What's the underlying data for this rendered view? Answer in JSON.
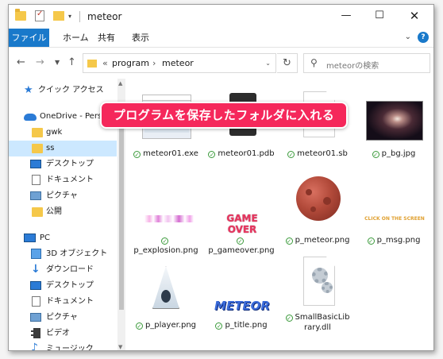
{
  "window": {
    "title": "meteor",
    "controls": {
      "minimize": "—",
      "maximize": "☐",
      "close": "✕"
    }
  },
  "ribbon": {
    "tabs": [
      "ファイル",
      "ホーム",
      "共有",
      "表示"
    ]
  },
  "address": {
    "prefix": "«",
    "crumbs": [
      "program",
      "meteor"
    ],
    "separator": "›"
  },
  "search": {
    "placeholder": "meteorの検索"
  },
  "sidebar": {
    "items": [
      {
        "label": "クイック アクセス",
        "icon": "star-icon"
      },
      {
        "label": "OneDrive - Person",
        "icon": "cloud-icon"
      },
      {
        "label": "gwk",
        "icon": "folder-icon"
      },
      {
        "label": "ss",
        "icon": "folder-icon",
        "selected": true
      },
      {
        "label": "デスクトップ",
        "icon": "desktop-icon"
      },
      {
        "label": "ドキュメント",
        "icon": "document-icon"
      },
      {
        "label": "ピクチャ",
        "icon": "pictures-icon"
      },
      {
        "label": "公開",
        "icon": "folder-icon"
      },
      {
        "label": "PC",
        "icon": "pc-icon"
      },
      {
        "label": "3D オブジェクト",
        "icon": "3d-objects-icon"
      },
      {
        "label": "ダウンロード",
        "icon": "download-icon"
      },
      {
        "label": "デスクトップ",
        "icon": "desktop-icon"
      },
      {
        "label": "ドキュメント",
        "icon": "document-icon"
      },
      {
        "label": "ピクチャ",
        "icon": "pictures-icon"
      },
      {
        "label": "ビデオ",
        "icon": "video-icon"
      },
      {
        "label": "ミュージック",
        "icon": "music-icon"
      }
    ]
  },
  "files": [
    {
      "name": "meteor01.exe",
      "thumb": "exe-window"
    },
    {
      "name": "meteor01.pdb",
      "thumb": "pdb-icon"
    },
    {
      "name": "meteor01.sb",
      "thumb": "blank-file"
    },
    {
      "name": "p_bg.jpg",
      "thumb": "space-image"
    },
    {
      "name": "p_explosion.png",
      "thumb": "explosion-strip"
    },
    {
      "name": "p_gameover.png",
      "thumb": "gameover-text",
      "thumb_text": "GAME OVER"
    },
    {
      "name": "p_meteor.png",
      "thumb": "meteor-rock"
    },
    {
      "name": "p_msg.png",
      "thumb": "msg-text",
      "thumb_text": "CLICK ON THE SCREEN"
    },
    {
      "name": "p_player.png",
      "thumb": "player-ship"
    },
    {
      "name": "p_title.png",
      "thumb": "title-text",
      "thumb_text": "METEOR"
    },
    {
      "name": "SmallBasicLib\nrary.dll",
      "thumb": "dll-gears"
    }
  ],
  "status_icon": "✓",
  "callout": {
    "text": "プログラムを保存したフォルダに入れる"
  }
}
